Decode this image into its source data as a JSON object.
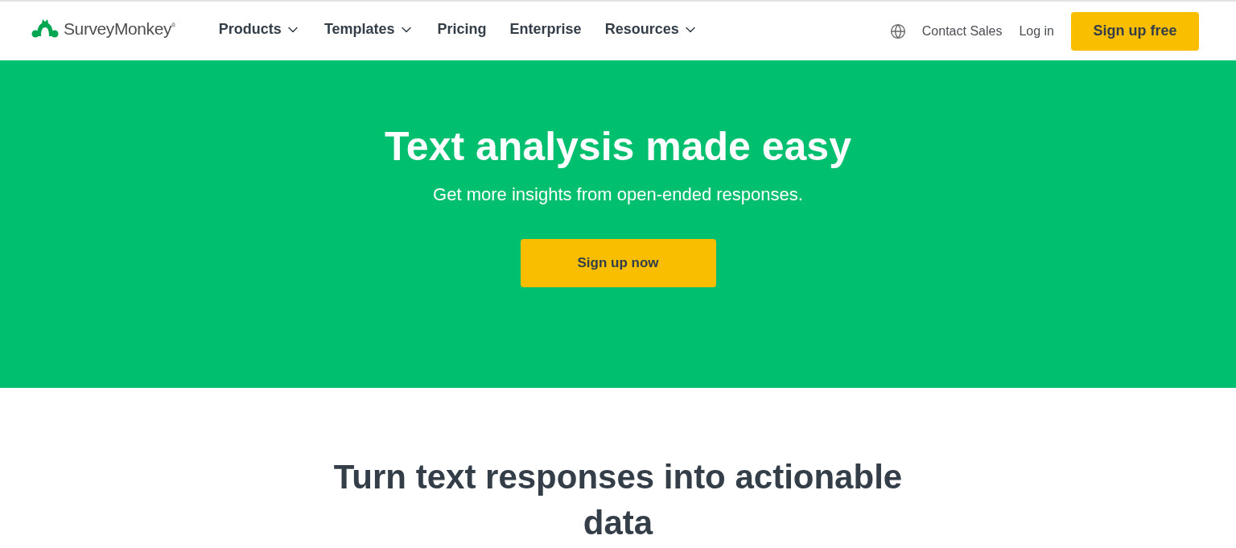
{
  "header": {
    "logo": "SurveyMonkey$^{®}$",
    "nav": [
      {
        "label": "Products",
        "has_menu": true
      },
      {
        "label": "Templates",
        "has_menu": true
      },
      {
        "label": "Pricing",
        "has_menu": false
      },
      {
        "label": "Enterprise",
        "has_menu": false
      },
      {
        "label": "Resources",
        "has_menu": true
      }
    ],
    "links": [
      "Contact Sales",
      "Log in"
    ],
    "cta": "Sign up free"
  },
  "hero": {
    "title": "Text analysis made easy",
    "subtitle": "Get more insights from open-ended responses.",
    "button": "Sign up now"
  },
  "section": {
    "title": "Turn text responses into actionable data"
  }
}
